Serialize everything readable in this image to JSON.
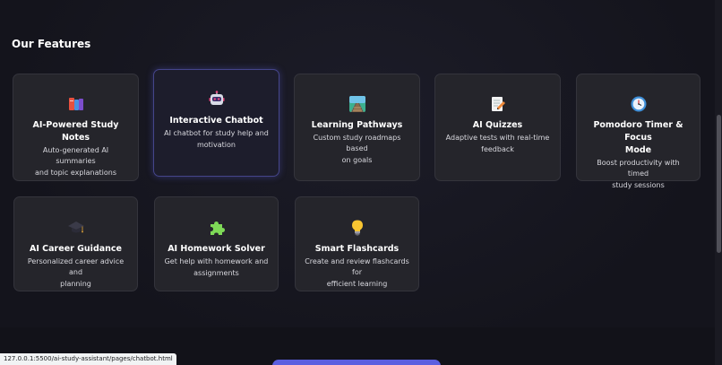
{
  "section": {
    "title": "Our Features"
  },
  "colors": {
    "accent": "#5b5fe0",
    "card_bg": "#25252b",
    "page_bg": "#161620"
  },
  "features": [
    {
      "title": "AI-Powered Study Notes",
      "desc_lines": [
        "Auto-generated AI summaries",
        "and topic explanations"
      ],
      "icon": "books-icon"
    },
    {
      "title": "Interactive Chatbot",
      "desc_lines": [
        "AI chatbot for study help and",
        "motivation"
      ],
      "icon": "robot-icon"
    },
    {
      "title": "Learning Pathways",
      "desc_lines": [
        "Custom study roadmaps based",
        "on goals"
      ],
      "icon": "railway-track-icon"
    },
    {
      "title": "AI Quizzes",
      "desc_lines": [
        "Adaptive tests with real-time",
        "feedback"
      ],
      "icon": "memo-pencil-icon"
    },
    {
      "title_lines": [
        "Pomodoro Timer & Focus",
        "Mode"
      ],
      "desc_lines": [
        "Boost productivity with timed",
        "study sessions"
      ],
      "icon": "stopwatch-icon"
    },
    {
      "title": "AI Career Guidance",
      "desc_lines": [
        "Personalized career advice and",
        "planning"
      ],
      "icon": "graduation-cap-icon"
    },
    {
      "title": "AI Homework Solver",
      "desc_lines": [
        "Get help with homework and",
        "assignments"
      ],
      "icon": "puzzle-piece-icon"
    },
    {
      "title": "Smart Flashcards",
      "desc_lines": [
        "Create and review flashcards for",
        "efficient learning"
      ],
      "icon": "light-bulb-icon"
    }
  ],
  "status_bar": {
    "url": "127.0.0.1:5500/ai-study-assistant/pages/chatbot.html"
  }
}
